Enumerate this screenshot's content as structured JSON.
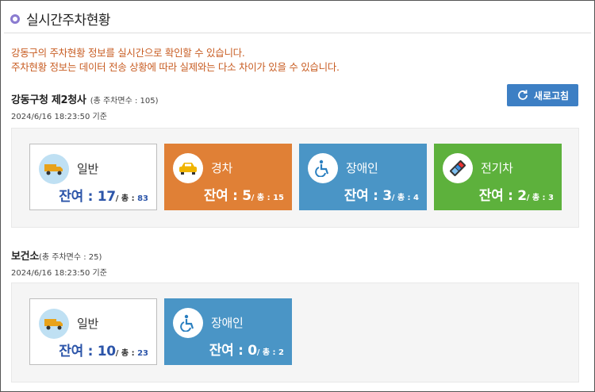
{
  "page_title": "실시간주차현황",
  "notice": {
    "line1": "강동구의 주차현황 정보를 실시간으로 확인할 수 있습니다.",
    "line2": "주차현황 정보는 데이터 전송 상황에 따라 실제와는 다소 차이가 있을 수 있습니다."
  },
  "refresh_label": "새로고침",
  "colors": {
    "accent": "#3d7fc4",
    "orange": "#e08036",
    "blue": "#4a95c6",
    "green": "#5db13c",
    "notice": "#c85d23"
  },
  "lots": [
    {
      "name": "강동구청 제2청사",
      "total_text": "(총 주차면수 : 105)",
      "timestamp": "2024/6/16 18:23:50 기준",
      "cards": [
        {
          "label": "일반",
          "remain": "잔여 : 17",
          "total_prefix": "/ 총 : ",
          "total": "83",
          "icon": "truck-icon"
        },
        {
          "label": "경차",
          "remain": "잔여 : 5",
          "total_prefix": "/ 총 : ",
          "total": "15",
          "icon": "car-icon"
        },
        {
          "label": "장애인",
          "remain": "잔여 : 3",
          "total_prefix": "/ 총 : ",
          "total": "4",
          "icon": "wheelchair-icon"
        },
        {
          "label": "전기차",
          "remain": "잔여 : 2",
          "total_prefix": "/ 총 : ",
          "total": "3",
          "icon": "battery-icon"
        }
      ]
    },
    {
      "name": "보건소",
      "total_text": "(총 주차면수 : 25)",
      "timestamp": "2024/6/16 18:23:50 기준",
      "cards": [
        {
          "label": "일반",
          "remain": "잔여 : 10",
          "total_prefix": "/ 총 : ",
          "total": "23",
          "icon": "truck-icon"
        },
        {
          "label": "장애인",
          "remain": "잔여 : 0",
          "total_prefix": "/ 총 : ",
          "total": "2",
          "icon": "wheelchair-icon"
        }
      ]
    }
  ]
}
